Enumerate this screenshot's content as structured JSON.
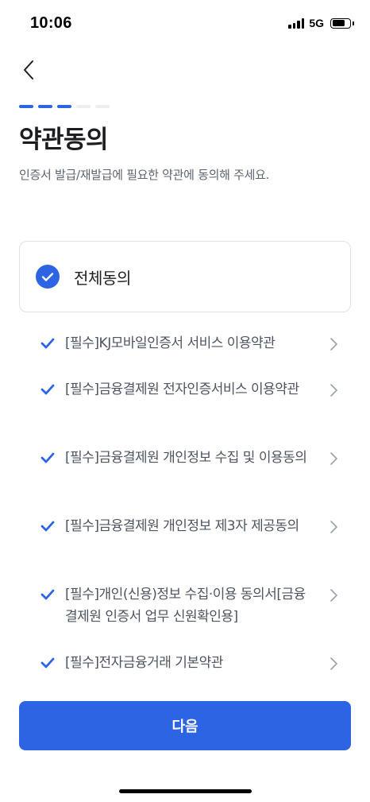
{
  "status_bar": {
    "time": "10:06",
    "network": "5G",
    "battery_level": 0.75
  },
  "header": {
    "back_icon": "chevron-left-icon",
    "step_progress": {
      "total": 5,
      "completed": 3
    }
  },
  "page": {
    "title": "약관동의",
    "subtitle": "인증서 발급/재발급에 필요한 약관에 동의해 주세요."
  },
  "agree_all": {
    "label": "전체동의",
    "checked": true
  },
  "terms": [
    {
      "label": "[필수]KJ모바일인증서 서비스 이용약관",
      "checked": true
    },
    {
      "label": "[필수]금융결제원 전자인증서비스 이용약관",
      "checked": true
    },
    {
      "label": "[필수]금융결제원 개인정보 수집 및 이용동의",
      "checked": true
    },
    {
      "label": "[필수]금융결제원 개인정보 제3자 제공동의",
      "checked": true
    },
    {
      "label": "[필수]개인(신용)정보 수집·이용 동의서[금융결제원 인증서 업무 신원확인용]",
      "checked": true
    },
    {
      "label": "[필수]전자금융거래 기본약관",
      "checked": true
    }
  ],
  "next_button": {
    "label": "다음"
  },
  "colors": {
    "accent": "#2d64e3",
    "progress_inactive": "#eceef2",
    "text_primary": "#1b1d21",
    "text_secondary": "#4e5461",
    "chevron": "#9aa0aa"
  }
}
